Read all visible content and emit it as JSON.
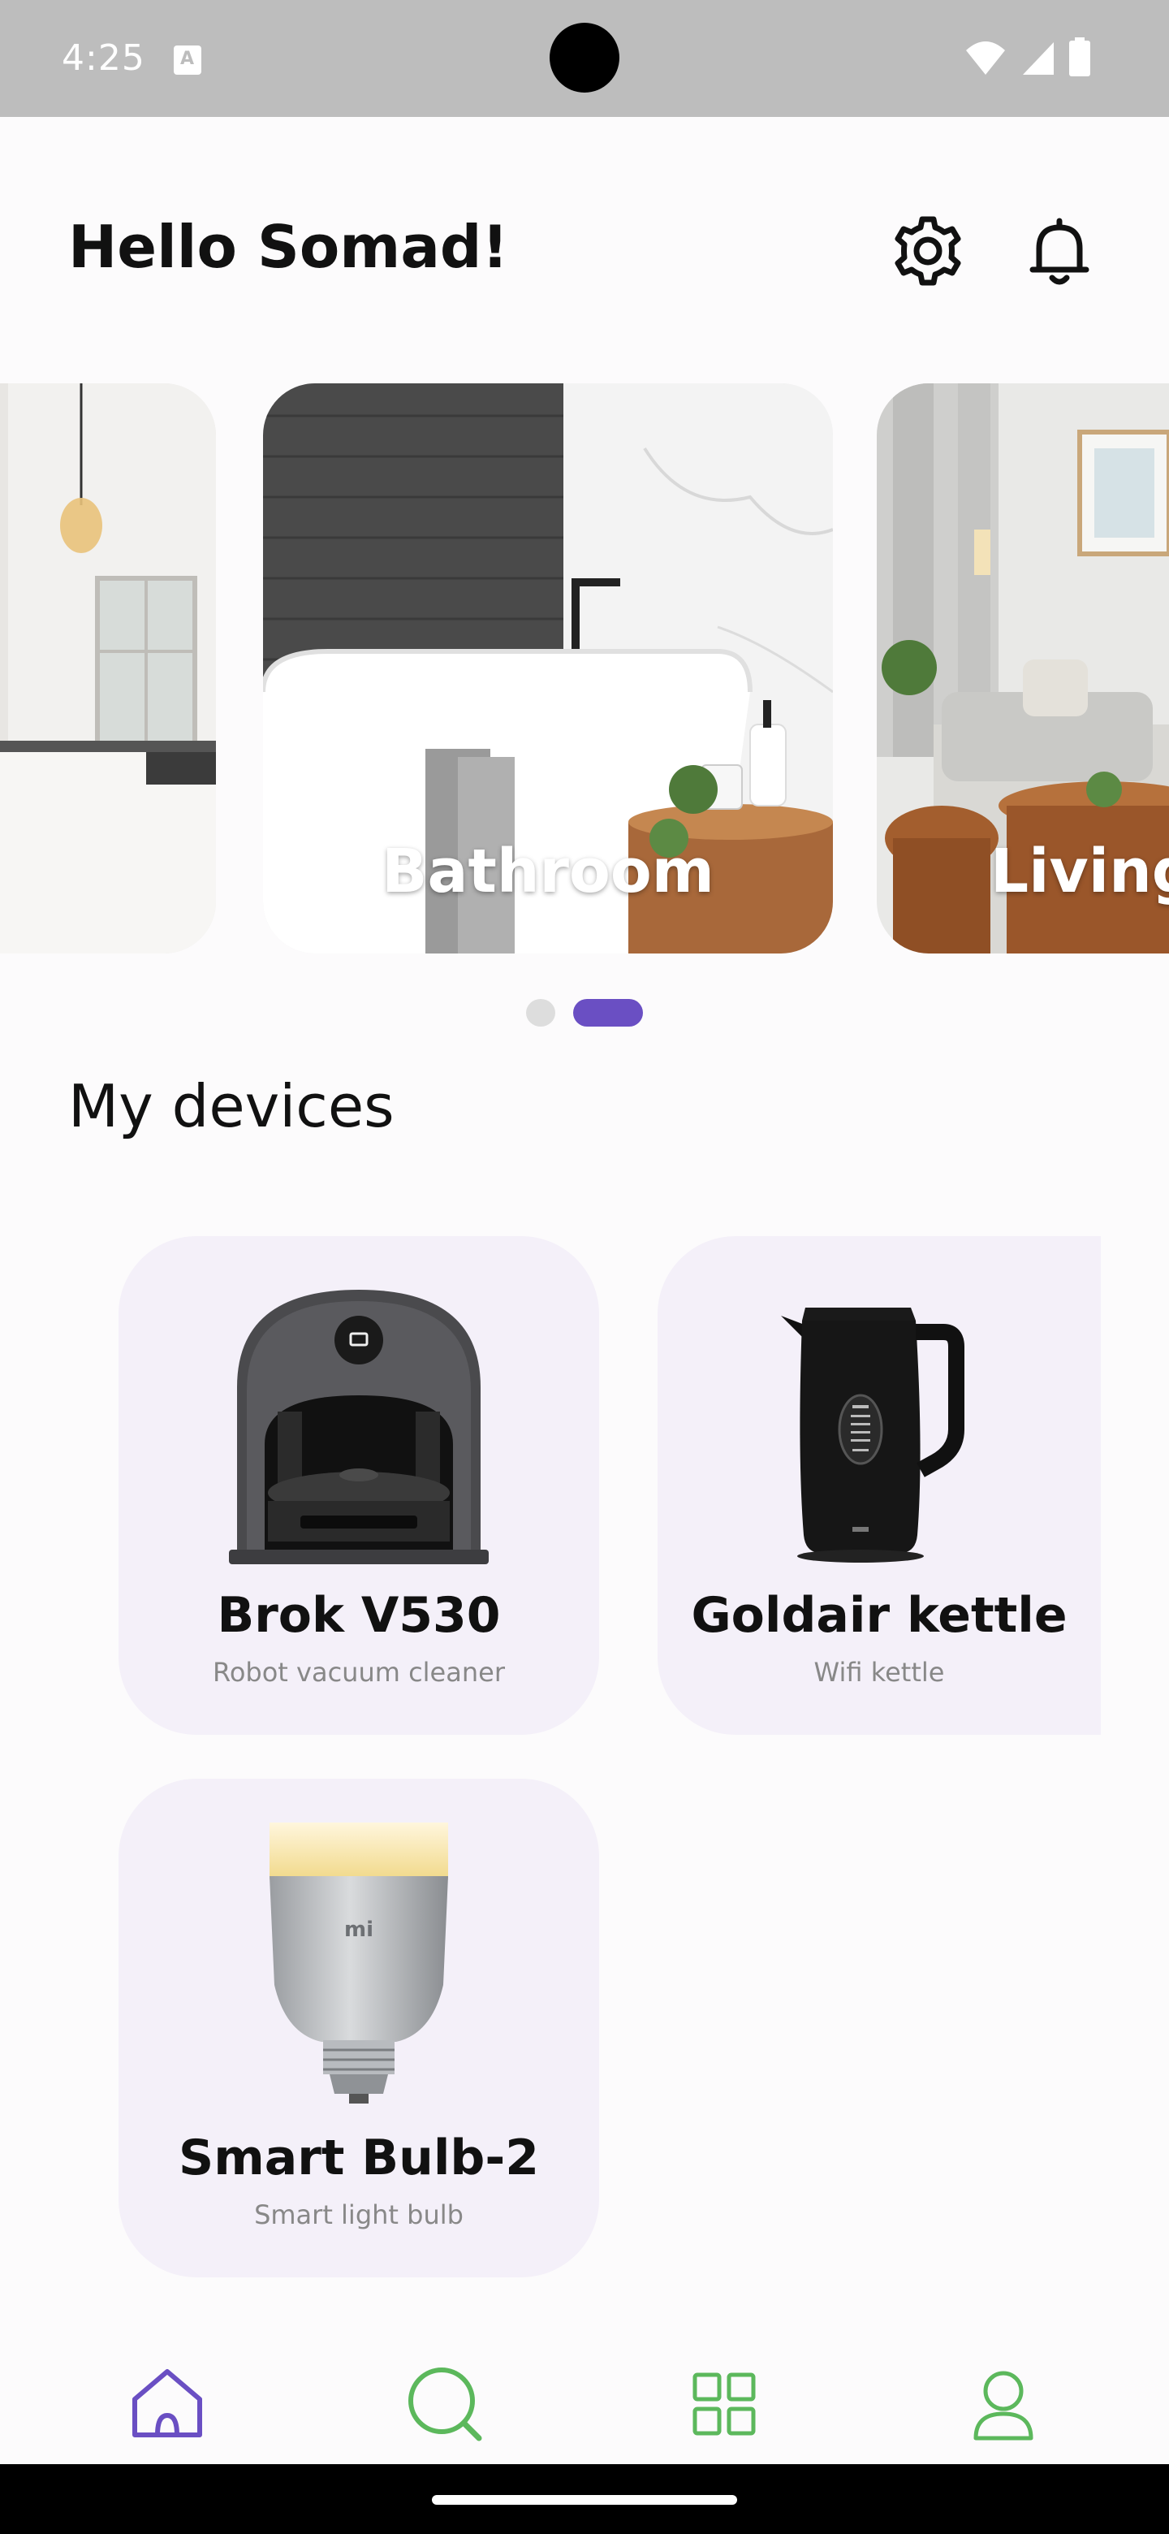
{
  "status_bar": {
    "time": "4:25"
  },
  "header": {
    "greeting": "Hello Somad!"
  },
  "rooms": [
    {
      "label": ""
    },
    {
      "label": "Bathroom"
    },
    {
      "label": "Living"
    }
  ],
  "carousel": {
    "active_index": 1,
    "page_count": 2
  },
  "devices_section": {
    "title": "My devices",
    "items": [
      {
        "name": "Brok V530",
        "subtitle": "Robot vacuum cleaner"
      },
      {
        "name": "Goldair kettle",
        "subtitle": "Wifi kettle"
      },
      {
        "name": "Smart Bulb-2",
        "subtitle": "Smart light bulb"
      }
    ]
  },
  "bottom_nav": {
    "items": [
      "home-icon",
      "search-icon",
      "grid-icon",
      "profile-icon"
    ],
    "active": "home-icon"
  },
  "colors": {
    "accent": "#6a4fc3",
    "nav_inactive": "#5cb85c",
    "card_bg": "#f4f0f9",
    "status_bar": "#bdbdbd"
  }
}
